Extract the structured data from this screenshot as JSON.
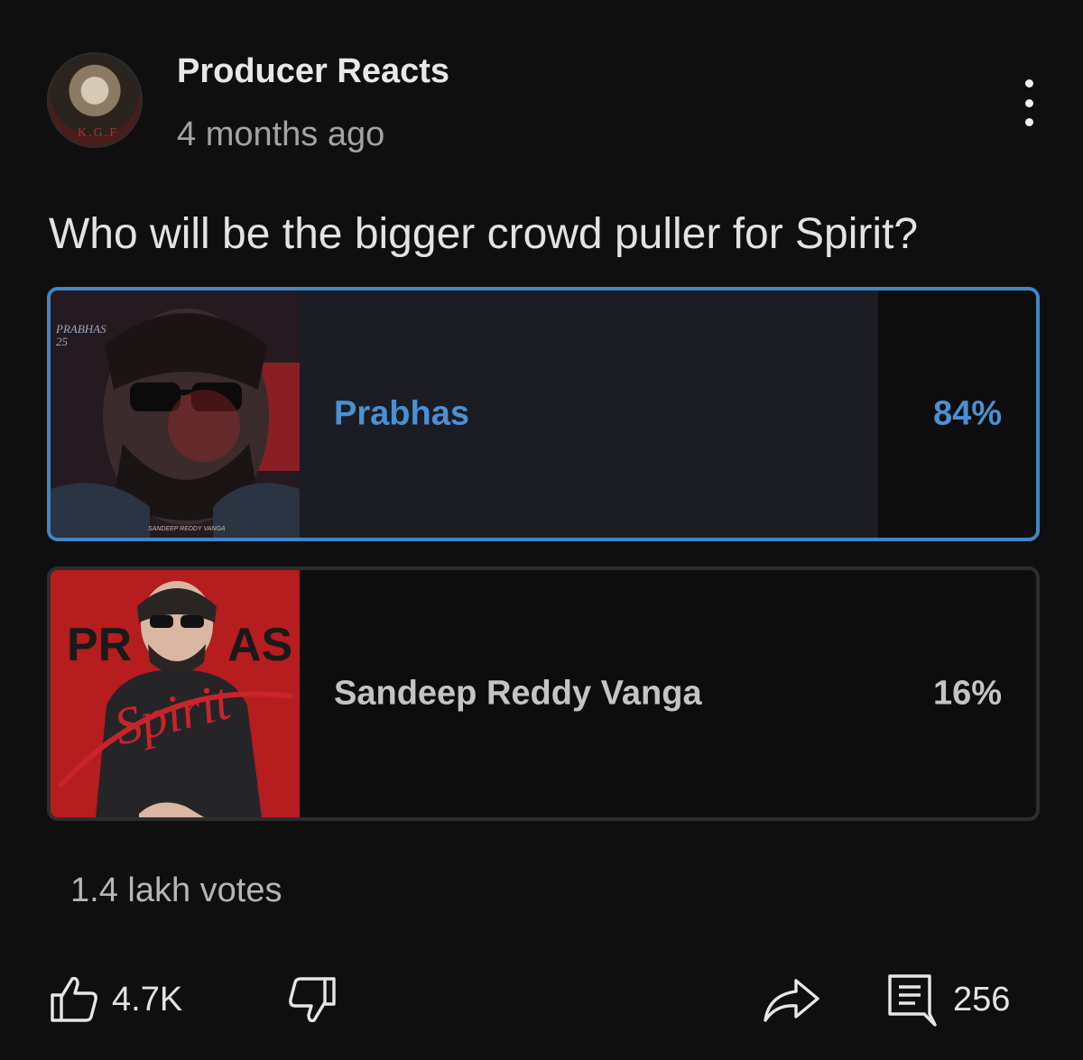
{
  "header": {
    "channel_name": "Producer Reacts",
    "time": "4 months ago",
    "avatar_text": "K.G.F",
    "more_icon": "more-vertical-icon"
  },
  "post": {
    "question": "Who will be the bigger crowd puller for Spirit?"
  },
  "poll": {
    "options": [
      {
        "label": "Prabhas",
        "percent_text": "84%",
        "percent": 84,
        "selected": true,
        "thumb_text_top": "PRABHAS 25",
        "thumb_text_bottom": "SANDEEP REDDY VANGA"
      },
      {
        "label": "Sandeep Reddy Vanga",
        "percent_text": "16%",
        "percent": 16,
        "selected": false,
        "thumb_text": "Spirit"
      }
    ],
    "votes_text": "1.4 lakh votes"
  },
  "actions": {
    "likes": "4.7K",
    "comments": "256",
    "like_icon": "thumbs-up-icon",
    "dislike_icon": "thumbs-down-icon",
    "share_icon": "share-icon",
    "comment_icon": "comment-icon"
  },
  "colors": {
    "accent": "#3f86c6",
    "background": "#0f0f10",
    "selected_fill": "#1b1c24",
    "other_fill": "#2f2f30"
  }
}
